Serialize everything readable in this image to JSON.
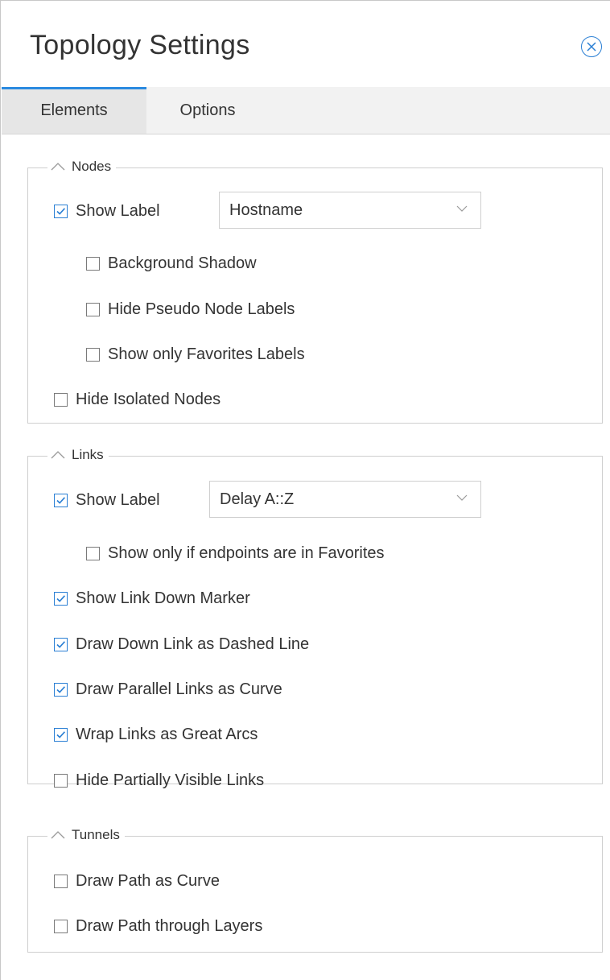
{
  "window": {
    "title": "Topology Settings",
    "close_icon": "close-circle-icon"
  },
  "tabs": [
    {
      "label": "Elements",
      "active": true
    },
    {
      "label": "Options",
      "active": false
    }
  ],
  "groups": {
    "nodes": {
      "legend": "Nodes",
      "show_label": {
        "label": "Show Label",
        "checked": true
      },
      "label_select": {
        "value": "Hostname"
      },
      "options": [
        {
          "label": "Background Shadow",
          "checked": false
        },
        {
          "label": "Hide Pseudo Node Labels",
          "checked": false
        },
        {
          "label": "Show only Favorites Labels",
          "checked": false
        },
        {
          "label": "Hide Isolated Nodes",
          "checked": false
        }
      ]
    },
    "links": {
      "legend": "Links",
      "show_label": {
        "label": "Show Label",
        "checked": true
      },
      "label_select": {
        "value": "Delay A::Z"
      },
      "options": [
        {
          "label": "Show only if endpoints are in Favorites",
          "checked": false
        },
        {
          "label": "Show Link Down Marker",
          "checked": true
        },
        {
          "label": "Draw Down Link as Dashed Line",
          "checked": true
        },
        {
          "label": "Draw Parallel Links as Curve",
          "checked": true
        },
        {
          "label": "Wrap Links as Great Arcs",
          "checked": true
        },
        {
          "label": "Hide Partially Visible Links",
          "checked": false
        }
      ]
    },
    "tunnels": {
      "legend": "Tunnels",
      "options": [
        {
          "label": "Draw Path as Curve",
          "checked": false
        },
        {
          "label": "Draw Path through Layers",
          "checked": false
        }
      ]
    }
  },
  "colors": {
    "accent": "#2a8ae0",
    "border": "#cfcfcf",
    "tab_bg": "#f2f2f2",
    "text": "#333333"
  }
}
